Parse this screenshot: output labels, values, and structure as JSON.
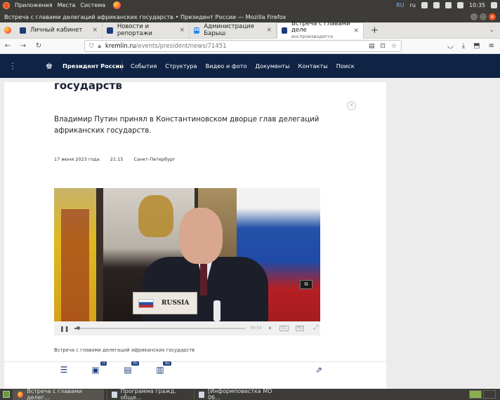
{
  "system_panel": {
    "menus": [
      "Приложения",
      "Места",
      "Система"
    ],
    "keyboard_layout": "RU",
    "locale": "ru",
    "clock": "10:35"
  },
  "window": {
    "title": "Встреча с главами делегаций африканских государств • Президент России — Mozilla Firefox"
  },
  "tabs": [
    {
      "label": "Личный кабинет",
      "icon": "kremlin-favicon"
    },
    {
      "label": "Новости и репортажи",
      "icon": "kremlin-favicon"
    },
    {
      "label": "Администрация Барыш",
      "icon": "vk-favicon"
    },
    {
      "label": "Встреча с главами деле",
      "sublabel": "воспроизводится",
      "icon": "kremlin-favicon",
      "active": true
    }
  ],
  "address_bar": {
    "host": "kremlin.ru",
    "path": "/events/president/news/71451"
  },
  "site_header": {
    "site_name": "Президент России",
    "nav": [
      "События",
      "Структура",
      "Видео и фото",
      "Документы",
      "Контакты",
      "Поиск"
    ]
  },
  "article": {
    "title": "государств",
    "lead": "Владимир Путин принял в Константиновском дворце глав делегаций африканских государств.",
    "date": "17 июня 2023 года",
    "time": "21:15",
    "place": "Санкт-Петербург",
    "video": {
      "nameplate": "RUSSIA",
      "progress_fraction": 0.02,
      "duration": "55:53"
    },
    "caption": "Встреча с главами делегаций африканских государств",
    "bottom_badges": {
      "photos": "12",
      "video": "16s",
      "hd": "4ba"
    }
  },
  "taskbar": {
    "items": [
      {
        "label": "Встреча с главами делег...",
        "icon": "firefox-icon",
        "active": true
      },
      {
        "label": "Программа гражд. обще...",
        "icon": "document-icon"
      },
      {
        "label": "[Информповестка МО 06...",
        "icon": "document-icon"
      }
    ]
  }
}
